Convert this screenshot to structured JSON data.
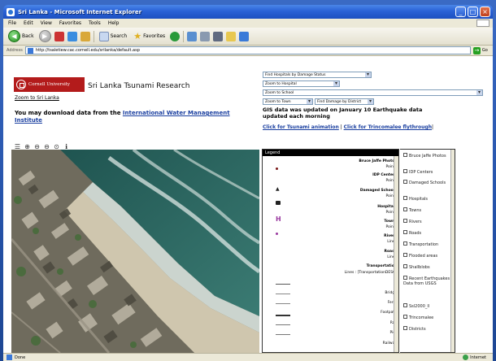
{
  "window": {
    "title": "Sri Lanka - Microsoft Internet Explorer",
    "minimize": "_",
    "maximize": "□",
    "close": "×"
  },
  "menu": [
    "File",
    "Edit",
    "View",
    "Favorites",
    "Tools",
    "Help"
  ],
  "toolbar": {
    "back_label": "Back",
    "search_label": "Search",
    "favorites_label": "Favorites"
  },
  "address": {
    "label": "Address",
    "url": "http://tsaletiew.cac.cornell.edu/srilanka/default.asp",
    "go_label": "Go"
  },
  "page": {
    "logo_text": "Cornell University",
    "site_title": "Sri Lanka Tsunami Research",
    "zoom_sri_lanka": "Zoom to Sri Lanka",
    "download_text": "You may download data from the",
    "download_link": "International Water Management Institute",
    "selects": {
      "find_hospitals": "Find Hospitals by Damage Status",
      "zoom_hospital": "Zoom to Hospital",
      "zoom_school": "Zoom to School",
      "zoom_town": "Zoom to Town",
      "find_damage": "Find Damage by District"
    },
    "gis_text": "GIS data was updated on January 10 Earthquake data updated each morning",
    "anim_link_1": "Click for Tsunami animation",
    "anim_sep": " | ",
    "anim_link_2": "Click for Trincomalee flythrough",
    "anim_end": "|"
  },
  "map_tools": [
    "☰",
    "⊕",
    "⊖",
    "⊖",
    "⊙",
    "ℹ"
  ],
  "legend": {
    "title": "Legend",
    "rows": [
      {
        "text": "Bruce Jaffe Photos",
        "bold": true
      },
      {
        "text": "Points",
        "bold": false
      },
      {
        "text": "IDP Centers",
        "bold": true
      },
      {
        "text": "Points",
        "bold": false
      },
      {
        "text": "Damaged Schools",
        "bold": true
      },
      {
        "text": "Points",
        "bold": false
      },
      {
        "text": "Hospitals",
        "bold": true
      },
      {
        "text": "Points",
        "bold": false
      },
      {
        "text": "Towns",
        "bold": true
      },
      {
        "text": "Points",
        "bold": false
      },
      {
        "text": "Rivers",
        "bold": true
      },
      {
        "text": "Lines",
        "bold": false
      },
      {
        "text": "Roads",
        "bold": true
      },
      {
        "text": "Lines",
        "bold": false
      },
      {
        "text": "Transportation",
        "bold": true
      },
      {
        "text": "Lines : [TransportationDESC]",
        "bold": false
      },
      {
        "text": "Bridge",
        "bold": false
      },
      {
        "text": "Ferry",
        "bold": false
      },
      {
        "text": "Footpath",
        "bold": false
      },
      {
        "text": "Rail",
        "bold": false
      },
      {
        "text": "Pier",
        "bold": false
      },
      {
        "text": "Railway",
        "bold": false
      }
    ]
  },
  "layers": [
    "Bruce Jaffe Photos",
    "IDP Centers",
    "Damaged Schools",
    "Hospitals",
    "Towns",
    "Rivers",
    "Roads",
    "Transportation",
    "Flooded areas",
    "Shallblobs",
    "Recent Earthquakes Data from USGS",
    "Ssl2000_ll",
    "Trincomalee",
    "Districts"
  ],
  "status": {
    "left": "Done",
    "zone": "Internet"
  },
  "colors": {
    "cornell_red": "#b31b1b",
    "link_blue": "#1a3fa0",
    "xp_blue": "#2a62d6",
    "ocean": "#2f6a66",
    "foam": "#d6e2dc",
    "sand": "#c9bfa9"
  }
}
